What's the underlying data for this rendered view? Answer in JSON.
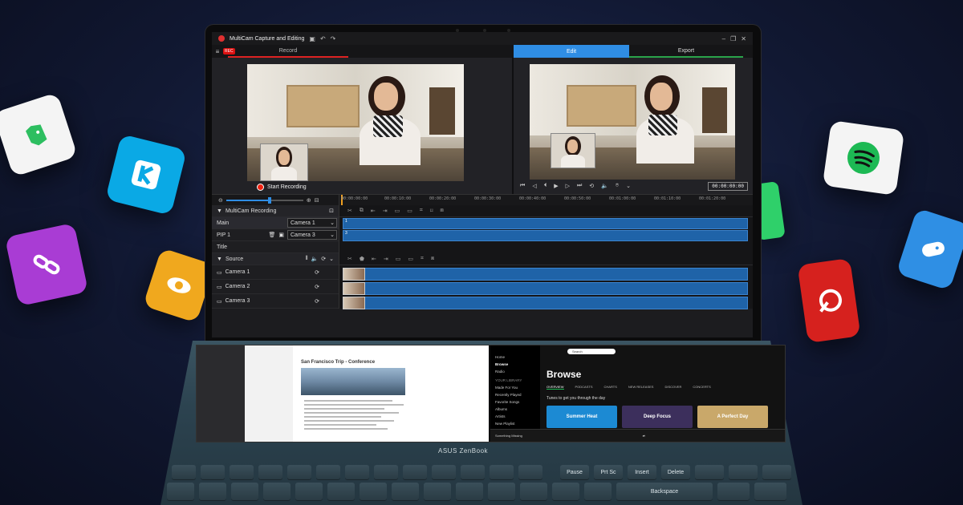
{
  "window": {
    "title": "MultiCam Capture and Editing"
  },
  "tabs": {
    "rec_badge": "REC",
    "record": "Record",
    "edit": "Edit",
    "export": "Export"
  },
  "record_panel": {
    "start_label": "Start Recording"
  },
  "player": {
    "timecode": "00:00:00:00"
  },
  "ruler": {
    "ticks": [
      "00:00:00:00",
      "00:00:10:00",
      "00:00:20:00",
      "00:00:30:00",
      "00:00:40:00",
      "00:00:50:00",
      "00:01:00:00",
      "00:01:10:00",
      "00:01:20:00"
    ]
  },
  "multicam": {
    "group_label": "MultiCam Recording",
    "main_label": "Main",
    "main_camera": "Camera 1",
    "pip_label": "PIP 1",
    "pip_camera": "Camera 3",
    "title_label": "Title",
    "clip1": "1",
    "clip3": "3"
  },
  "source": {
    "group_label": "Source",
    "cameras": [
      "Camera 1",
      "Camera 2",
      "Camera 3"
    ]
  },
  "pad": {
    "doc_title": "San Francisco Trip - Conference",
    "spotify": {
      "search": "Search",
      "nav": [
        "Home",
        "Browse",
        "Radio",
        "YOUR LIBRARY",
        "Made For You",
        "Recently Played",
        "Favorite Songs",
        "Albums",
        "Artists",
        "New Playlist"
      ],
      "heading": "Browse",
      "tabs": [
        "OVERVIEW",
        "PODCASTS",
        "CHARTS",
        "NEW RELEASES",
        "DISCOVER",
        "CONCERTS"
      ],
      "subtitle": "Tunes to get you through the day",
      "cards": [
        {
          "label": "Summer Heat",
          "color": "#1c8ad3"
        },
        {
          "label": "Deep Focus",
          "color": "#3c2f5c"
        },
        {
          "label": "A Perfect Day",
          "color": "#c9a86a"
        }
      ],
      "now_playing": "Something Missing"
    }
  },
  "brand": "ASUS ZenBook",
  "keys": {
    "fn_row": [
      "Pause",
      "Prt Sc",
      "Insert",
      "Delete"
    ],
    "backspace": "Backspace"
  },
  "colors": {
    "accent_blue": "#2f8de4",
    "rec_red": "#e02020",
    "clip_blue": "#1f63a8",
    "spotify_green": "#1db954"
  },
  "app_icons": [
    "evernote-icon",
    "kkbox-icon",
    "link-icon",
    "eye-icon",
    "spotify-icon",
    "gamepad-icon",
    "music-app-icon",
    "green-app-icon"
  ]
}
